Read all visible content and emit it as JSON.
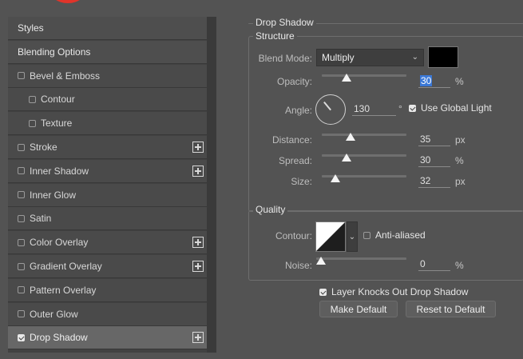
{
  "sidebar": {
    "items": [
      {
        "label": "Styles",
        "checked": false,
        "has_checkbox": false,
        "has_plus": false
      },
      {
        "label": "Blending Options",
        "checked": false,
        "has_checkbox": false,
        "has_plus": false
      },
      {
        "label": "Bevel & Emboss",
        "checked": false,
        "has_checkbox": true,
        "has_plus": false
      },
      {
        "label": "Contour",
        "checked": false,
        "has_checkbox": true,
        "has_plus": false
      },
      {
        "label": "Texture",
        "checked": false,
        "has_checkbox": true,
        "has_plus": false
      },
      {
        "label": "Stroke",
        "checked": false,
        "has_checkbox": true,
        "has_plus": true
      },
      {
        "label": "Inner Shadow",
        "checked": false,
        "has_checkbox": true,
        "has_plus": true
      },
      {
        "label": "Inner Glow",
        "checked": false,
        "has_checkbox": true,
        "has_plus": false
      },
      {
        "label": "Satin",
        "checked": false,
        "has_checkbox": true,
        "has_plus": false
      },
      {
        "label": "Color Overlay",
        "checked": false,
        "has_checkbox": true,
        "has_plus": true
      },
      {
        "label": "Gradient Overlay",
        "checked": false,
        "has_checkbox": true,
        "has_plus": true
      },
      {
        "label": "Pattern Overlay",
        "checked": false,
        "has_checkbox": true,
        "has_plus": false
      },
      {
        "label": "Outer Glow",
        "checked": false,
        "has_checkbox": true,
        "has_plus": false
      },
      {
        "label": "Drop Shadow",
        "checked": true,
        "has_checkbox": true,
        "has_plus": true
      }
    ]
  },
  "panel": {
    "title": "Drop Shadow",
    "structure": {
      "legend": "Structure",
      "blend_mode_label": "Blend Mode:",
      "blend_mode_value": "Multiply",
      "shadow_color": "#000000",
      "opacity_label": "Opacity:",
      "opacity_value": "30",
      "opacity_unit": "%",
      "angle_label": "Angle:",
      "angle_value": "130",
      "angle_unit": "°",
      "use_global_light_label": "Use Global Light",
      "use_global_light_checked": true,
      "distance_label": "Distance:",
      "distance_value": "35",
      "distance_unit": "px",
      "spread_label": "Spread:",
      "spread_value": "30",
      "spread_unit": "%",
      "size_label": "Size:",
      "size_value": "32",
      "size_unit": "px"
    },
    "quality": {
      "legend": "Quality",
      "contour_label": "Contour:",
      "anti_aliased_label": "Anti-aliased",
      "anti_aliased_checked": false,
      "noise_label": "Noise:",
      "noise_value": "0",
      "noise_unit": "%"
    },
    "layer_knocks_out_label": "Layer Knocks Out Drop Shadow",
    "layer_knocks_out_checked": true,
    "make_default_label": "Make Default",
    "reset_default_label": "Reset to Default"
  }
}
